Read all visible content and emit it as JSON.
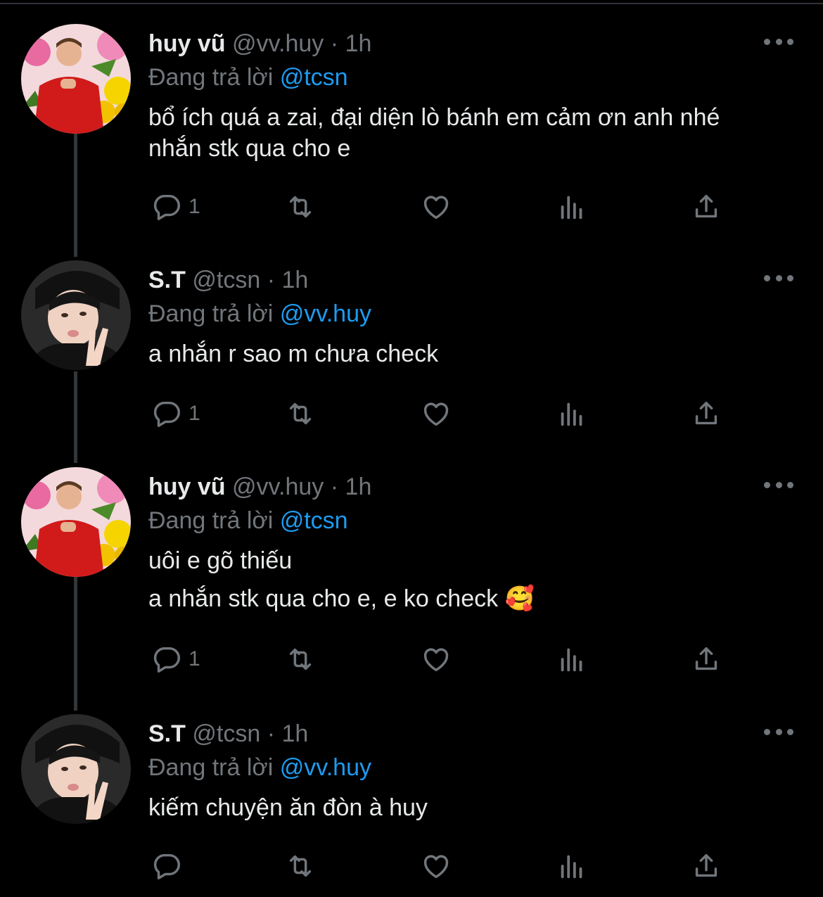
{
  "tweets": [
    {
      "name": "huy vũ",
      "handle": "@vv.huy",
      "separator": "·",
      "time": "1h",
      "reply_prefix": "Đang trả lời",
      "reply_to": "@tcsn",
      "lines": [
        "bổ ích quá a zai, đại diện lò bánh em cảm ơn anh nhé",
        "nhắn stk qua cho e"
      ],
      "reply_count": "1",
      "avatar": "avatar-huy"
    },
    {
      "name": "S.T",
      "handle": "@tcsn",
      "separator": "·",
      "time": "1h",
      "reply_prefix": "Đang trả lời",
      "reply_to": "@vv.huy",
      "lines": [
        "a nhắn r sao m chưa check"
      ],
      "reply_count": "1",
      "avatar": "avatar-st"
    },
    {
      "name": "huy vũ",
      "handle": "@vv.huy",
      "separator": "·",
      "time": "1h",
      "reply_prefix": "Đang trả lời",
      "reply_to": "@tcsn",
      "lines": [
        "uôi e gõ thiếu",
        "a nhắn stk qua cho e, e ko check 🥰"
      ],
      "reply_count": "1",
      "avatar": "avatar-huy"
    },
    {
      "name": "S.T",
      "handle": "@tcsn",
      "separator": "·",
      "time": "1h",
      "reply_prefix": "Đang trả lời",
      "reply_to": "@vv.huy",
      "lines": [
        "kiếm chuyện ăn đòn à huy"
      ],
      "reply_count": "",
      "avatar": "avatar-st"
    }
  ],
  "icons": {
    "reply": "reply-icon",
    "retweet": "retweet-icon",
    "like": "heart-icon",
    "views": "views-icon",
    "share": "share-icon",
    "more": "more-icon"
  },
  "colors": {
    "background": "#000000",
    "text": "#e7e9ea",
    "secondary": "#71767b",
    "mention": "#1d9bf0",
    "thread_line": "#333639"
  }
}
